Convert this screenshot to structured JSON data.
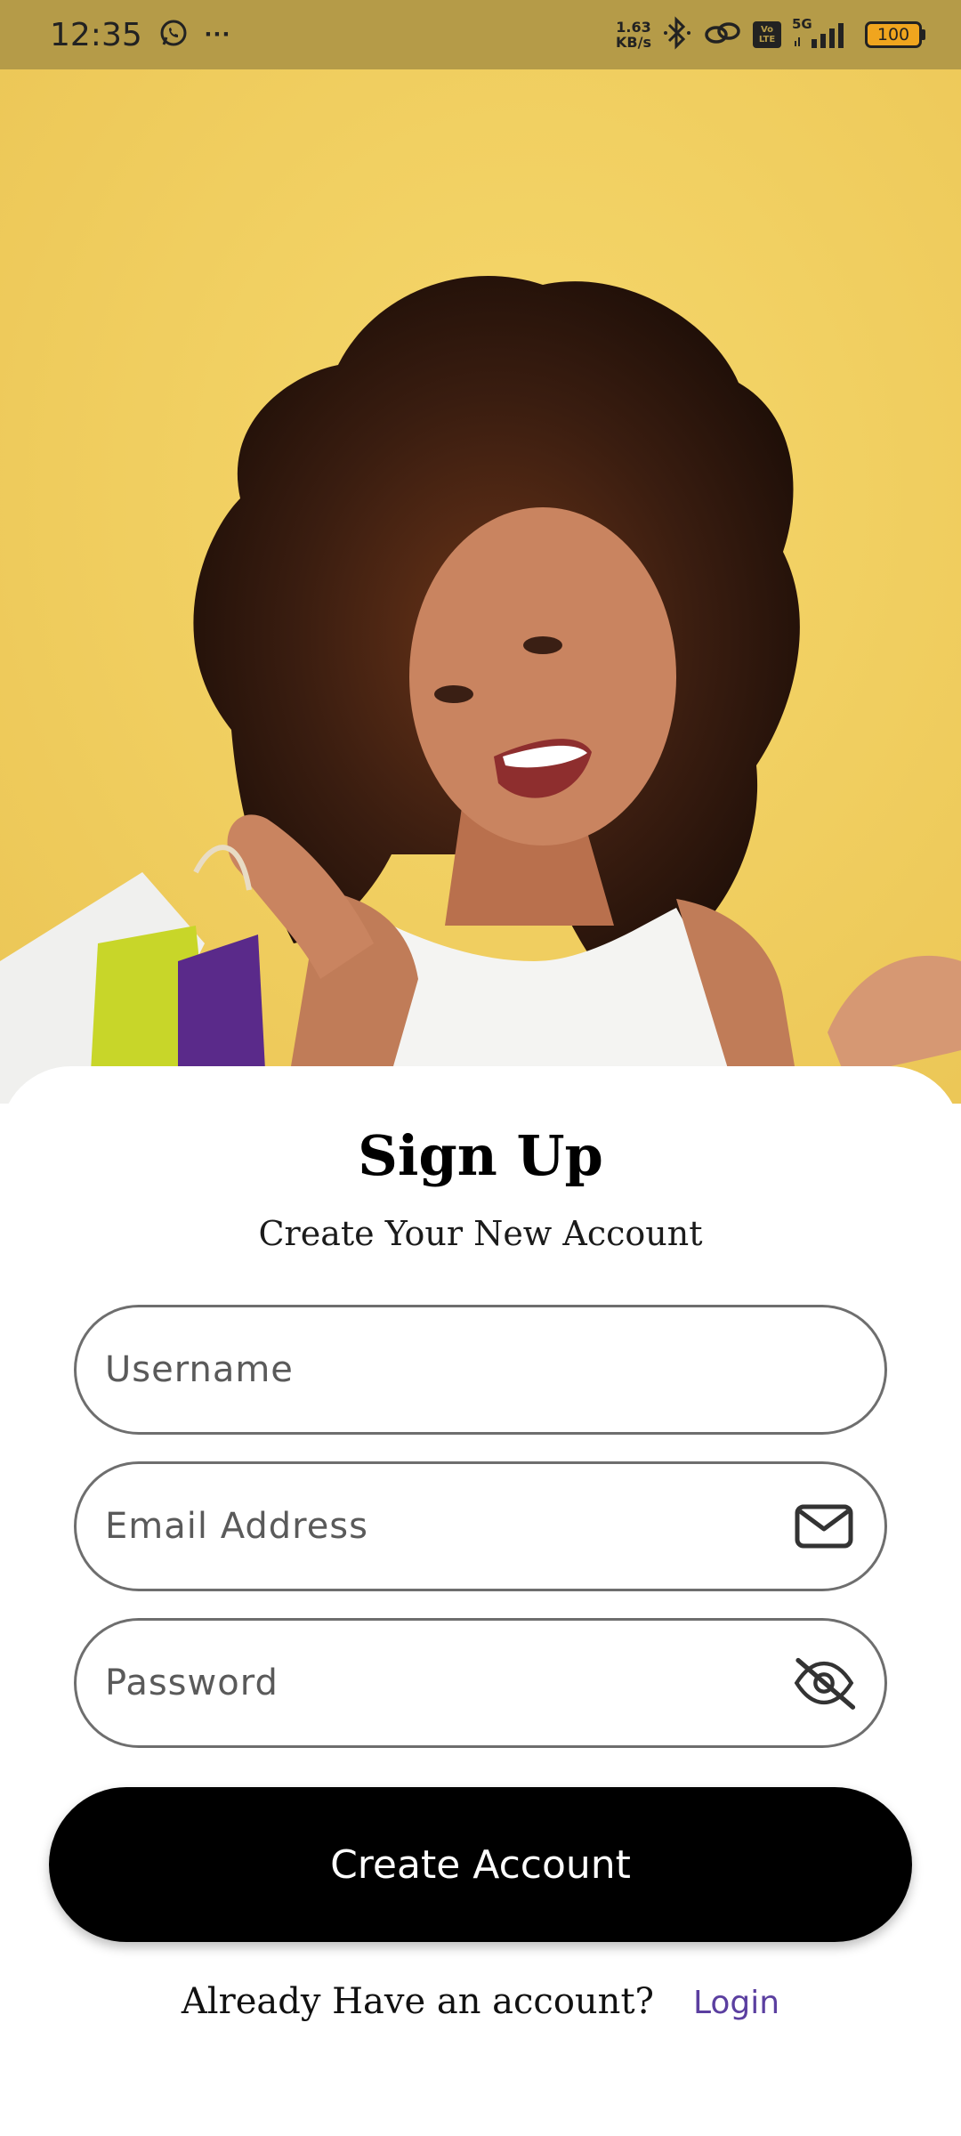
{
  "status_bar": {
    "time": "12:35",
    "more_dots": "···",
    "net_speed_value": "1.63",
    "net_speed_unit": "KB/s",
    "volte_top": "Vo",
    "volte_bottom": "LTE",
    "network_type": "5G",
    "battery": "100"
  },
  "hero": {
    "background_color": "#f0cf62",
    "image_subject": "smiling woman holding shopping bags"
  },
  "signup": {
    "title": "Sign Up",
    "subtitle": "Create Your New Account",
    "username_placeholder": "Username",
    "email_placeholder": "Email Address",
    "password_placeholder": "Password",
    "create_button": "Create Account",
    "login_prompt": "Already Have an account?",
    "login_link": "Login"
  },
  "icons": {
    "email": "envelope-icon",
    "password": "eye-slash-icon"
  },
  "colors": {
    "status_bar": "#b59b48",
    "button": "#000000",
    "link": "#5b3fa0"
  }
}
